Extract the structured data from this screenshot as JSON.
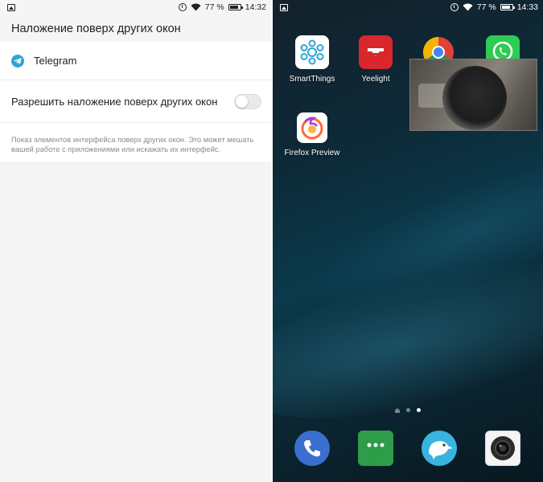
{
  "left": {
    "status": {
      "battery": "77 %",
      "time": "14:32"
    },
    "header": {
      "title": "Наложение поверх других окон"
    },
    "app_row": {
      "name": "Telegram"
    },
    "toggle_row": {
      "label": "Разрешить наложение поверх других окон",
      "enabled": false
    },
    "description": "Показ элементов интерфейса поверх других окон. Это может мешать вашей работе с приложениями или искажать их интерфейс."
  },
  "right": {
    "status": {
      "battery": "77 %",
      "time": "14:33"
    },
    "apps": [
      {
        "name": "SmartThings",
        "icon": "smartthings-icon"
      },
      {
        "name": "Yeelight",
        "icon": "yeelight-icon"
      },
      {
        "name": "",
        "icon": "chrome-icon"
      },
      {
        "name": "",
        "icon": "whatsapp-icon"
      },
      {
        "name": "Firefox Preview",
        "icon": "firefox-icon"
      }
    ],
    "page_indicator": {
      "pages": 3,
      "active": 2
    },
    "dock": [
      {
        "icon": "phone-icon"
      },
      {
        "icon": "messages-icon"
      },
      {
        "icon": "kiwi-browser-icon"
      },
      {
        "icon": "camera-icon"
      }
    ]
  },
  "colors": {
    "telegram": "#2fa3d8",
    "yeelight": "#d8272d",
    "whatsapp": "#2ecc52",
    "phone": "#3a6fd0",
    "messages": "#2e9d49",
    "kiwi": "#39b4e0"
  }
}
